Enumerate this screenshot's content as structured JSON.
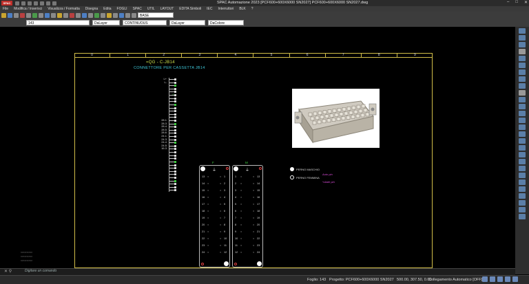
{
  "window": {
    "app_logo": "SPAC",
    "title": "SPAC Automazione 2023   [PCF600+600X6000 SN2027]   PCF600+600X6000 SN2027.dwg"
  },
  "menu": [
    "File",
    "Modifica / Inserisci",
    "Visualizza / Formatta",
    "Disegna",
    "Edita",
    "FOGLI",
    "SPAC",
    "UTIL",
    "LAYOUT",
    "EDITA Simboli",
    "IEC",
    "Interruttori",
    "BLK",
    "?"
  ],
  "toolbar": {
    "layer_select": "BASE",
    "page_field": "143",
    "layer_by": "DaLayer",
    "linetype": "CONTINUOUS",
    "lineweight": "DaLayer",
    "color": "DaColore"
  },
  "drawing": {
    "columns": [
      "0",
      "1",
      "2",
      "3",
      "4",
      "5",
      "6",
      "7",
      "8",
      "9"
    ],
    "title": "=QG - C-JB14",
    "subtitle": "CONNETTORE PER CASSETTA JB14",
    "strip_top_label": "XI",
    "strip_labels": [
      "L+",
      "L-",
      "",
      "",
      "",
      "",
      "",
      "",
      "",
      "",
      "",
      "",
      "",
      "28.1",
      "28.3",
      "28.4",
      "28.5",
      "28.6",
      "24.1",
      "24.3",
      "24.4",
      "24.5",
      "16.3",
      "",
      "",
      "",
      "",
      "",
      "",
      "",
      "",
      "",
      "",
      "",
      "",
      ""
    ],
    "connector_f": {
      "label": "F",
      "left": [
        "13",
        "14",
        "15",
        "16",
        "17",
        "18",
        "19",
        "20",
        "21",
        "22",
        "23",
        "24"
      ],
      "right": [
        "1",
        "2",
        "3",
        "4",
        "5",
        "6",
        "7",
        "8",
        "9",
        "10",
        "11",
        "12"
      ]
    },
    "connector_m": {
      "label": "M",
      "left": [
        "1",
        "2",
        "3",
        "4",
        "5",
        "6",
        "7",
        "8",
        "9",
        "10",
        "11",
        "12"
      ],
      "right": [
        "13",
        "14",
        "15",
        "16",
        "17",
        "18",
        "19",
        "20",
        "21",
        "22",
        "23",
        "24"
      ]
    },
    "legend_male": "PERNO MASCHIO",
    "legend_female": "PERNO FEMMINA",
    "note1": "Auto pin",
    "note2": "*ulade pin"
  },
  "cmd": {
    "prompt": "Digitare un comando"
  },
  "status": {
    "sheet": "Foglio: 143",
    "project": "Progetto: PCF600+600X6000 SN2027",
    "coords": "500.00, 307.50, 0.00",
    "autolink": "Collegamento Automatico [OFF]"
  }
}
